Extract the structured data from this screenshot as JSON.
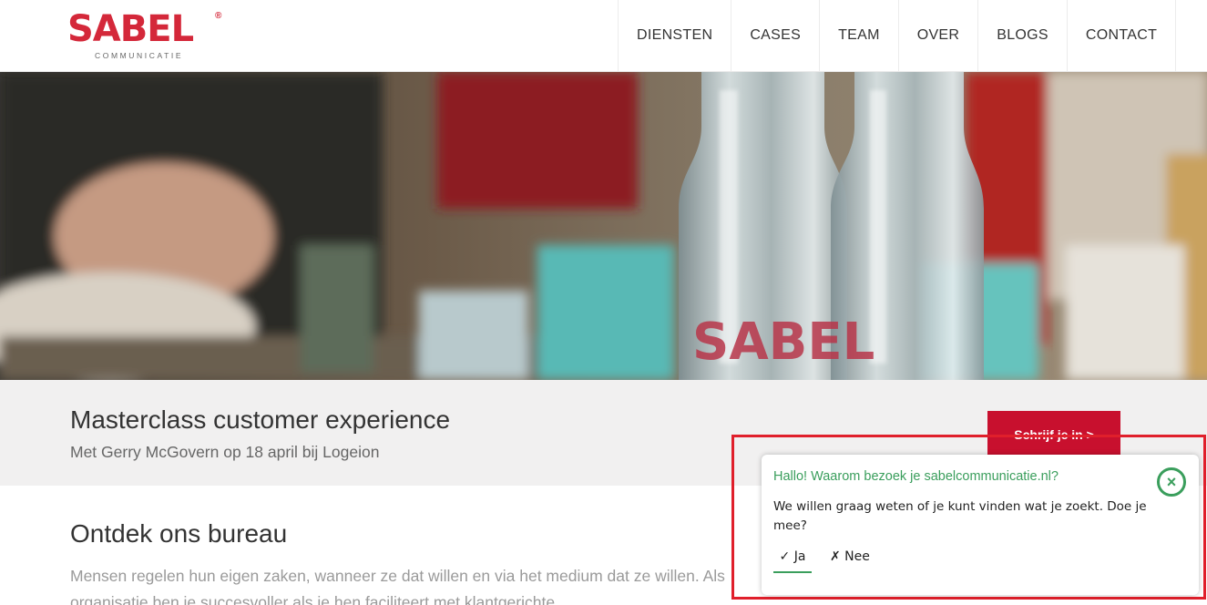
{
  "brand": {
    "name": "SABEL",
    "registered": "®",
    "tagline": "COMMUNICATIE",
    "color": "#d4283a"
  },
  "nav": [
    {
      "label": "DIENSTEN"
    },
    {
      "label": "CASES"
    },
    {
      "label": "TEAM"
    },
    {
      "label": "OVER"
    },
    {
      "label": "BLOGS"
    },
    {
      "label": "CONTACT"
    }
  ],
  "hero": {
    "bottle_label": "SABEL"
  },
  "promo": {
    "title": "Masterclass customer experience",
    "subtitle": "Met Gerry McGovern op 18 april bij Logeion",
    "button": "Schrijf je in >"
  },
  "intro": {
    "title": "Ontdek ons bureau",
    "text": "Mensen regelen hun eigen zaken, wanneer ze dat willen en via het medium dat ze willen. Als organisatie ben je succesvoller als je hen faciliteert met klantgerichte"
  },
  "feedback": {
    "question": "Hallo! Waarom bezoek je sabelcommunicatie.nl?",
    "text": "We willen graag weten of je kunt vinden wat je zoekt. Doe je mee?",
    "yes": "✓ Ja",
    "no": "✗ Nee",
    "close_icon": "×",
    "accent": "#3a9e5c"
  }
}
